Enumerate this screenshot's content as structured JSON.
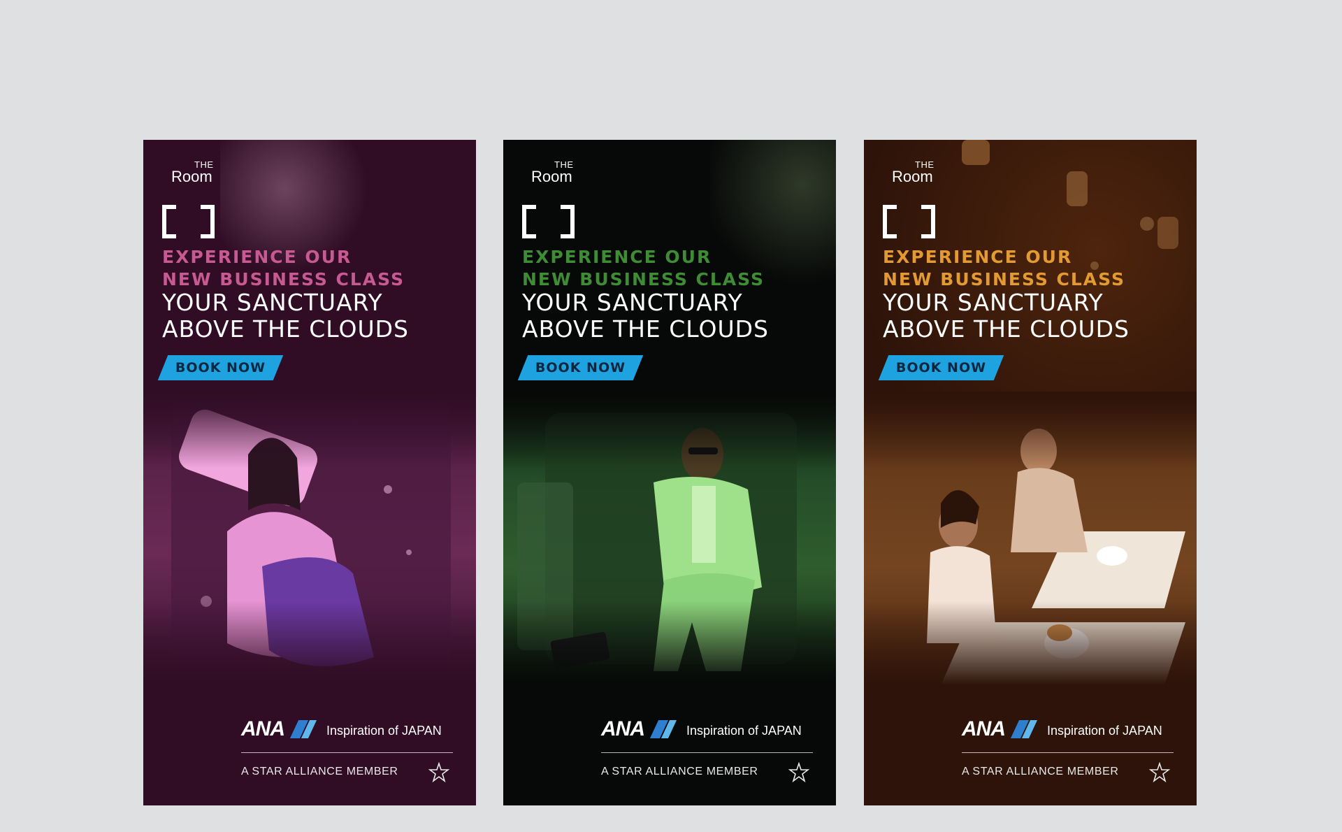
{
  "banners": [
    {
      "logo": {
        "the": "THE",
        "room": "Room"
      },
      "headline_line1": "EXPERIENCE OUR",
      "headline_line2": "NEW BUSINESS CLASS",
      "main_line1": "YOUR SANCTUARY",
      "main_line2": "ABOVE THE CLOUDS",
      "cta": "BOOK NOW",
      "brand": "ANA",
      "tagline": "Inspiration of JAPAN",
      "alliance": "A STAR ALLIANCE MEMBER",
      "accent": "#c75993",
      "background": "#300d25"
    },
    {
      "logo": {
        "the": "THE",
        "room": "Room"
      },
      "headline_line1": "EXPERIENCE OUR",
      "headline_line2": "NEW BUSINESS CLASS",
      "main_line1": "YOUR SANCTUARY",
      "main_line2": "ABOVE THE CLOUDS",
      "cta": "BOOK NOW",
      "brand": "ANA",
      "tagline": "Inspiration of JAPAN",
      "alliance": "A STAR ALLIANCE MEMBER",
      "accent": "#3e8d34",
      "background": "#070808"
    },
    {
      "logo": {
        "the": "THE",
        "room": "Room"
      },
      "headline_line1": "EXPERIENCE OUR",
      "headline_line2": "NEW BUSINESS CLASS",
      "main_line1": "YOUR SANCTUARY",
      "main_line2": "ABOVE THE CLOUDS",
      "cta": "BOOK NOW",
      "brand": "ANA",
      "tagline": "Inspiration of JAPAN",
      "alliance": "A STAR ALLIANCE MEMBER",
      "accent": "#e39a32",
      "background": "#2d1309"
    }
  ],
  "cta_color": "#1ea2e0",
  "icons": [
    "the-room-bracket-logo",
    "ana-stripe-logo",
    "star-alliance-icon"
  ]
}
